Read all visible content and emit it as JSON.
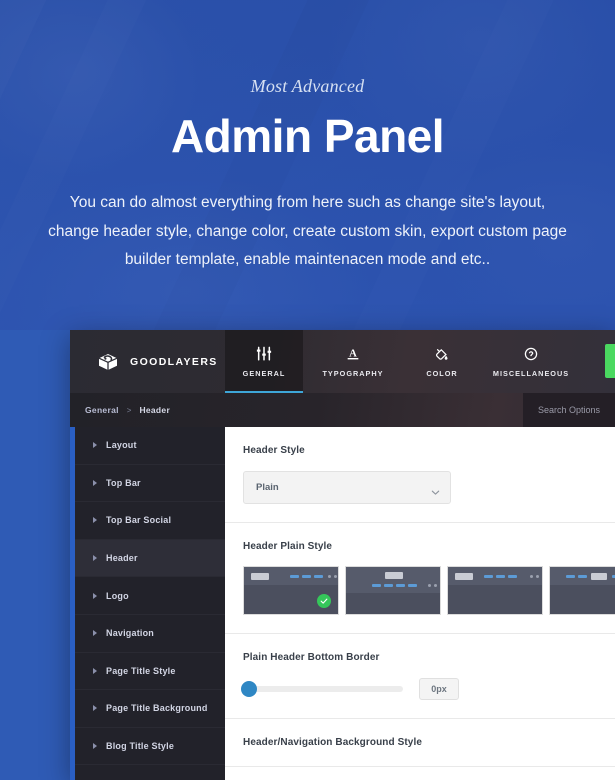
{
  "hero": {
    "eyebrow": "Most Advanced",
    "title": "Admin Panel",
    "description": "You can do almost everything from here such as change site's layout, change header style, change color, create custom skin, export custom page builder template, enable maintenacen mode and etc..",
    "bg_color": "#2f55a6"
  },
  "panel": {
    "brand": {
      "name": "GOODLAYERS",
      "icon": "cube-logo-icon"
    },
    "tabs": [
      {
        "label": "GENERAL",
        "icon": "sliders-icon",
        "active": true
      },
      {
        "label": "TYPOGRAPHY",
        "icon": "letter-a-underline-icon",
        "active": false
      },
      {
        "label": "COLOR",
        "icon": "paint-bucket-icon",
        "active": false
      },
      {
        "label": "MISCELLANEOUS",
        "icon": "circle-target-icon",
        "active": false
      }
    ],
    "save_button": {
      "label": "",
      "color": "#4ad860"
    },
    "breadcrumb": {
      "root": "General",
      "separator": ">",
      "current": "Header"
    },
    "search": {
      "placeholder": "Search Options",
      "value": ""
    },
    "sidebar": {
      "items": [
        {
          "label": "Layout",
          "active": false
        },
        {
          "label": "Top Bar",
          "active": false
        },
        {
          "label": "Top Bar Social",
          "active": false
        },
        {
          "label": "Header",
          "active": true
        },
        {
          "label": "Logo",
          "active": false
        },
        {
          "label": "Navigation",
          "active": false
        },
        {
          "label": "Page Title Style",
          "active": false
        },
        {
          "label": "Page Title Background",
          "active": false
        },
        {
          "label": "Blog Title Style",
          "active": false
        }
      ]
    },
    "fields": {
      "header_style": {
        "label": "Header Style",
        "selected": "Plain",
        "options": [
          "Plain"
        ]
      },
      "header_plain_style": {
        "label": "Header Plain Style",
        "selected_index": 0,
        "thumbnails": [
          {
            "name": "logo-left-nav-right",
            "selected": true
          },
          {
            "name": "logo-center-nav-below",
            "selected": false
          },
          {
            "name": "logo-left-nav-right-alt",
            "selected": false
          },
          {
            "name": "logo-center-nav-split",
            "selected": false
          }
        ]
      },
      "plain_header_bottom_border": {
        "label": "Plain Header Bottom Border",
        "value": "0px",
        "slider_percent": 0
      },
      "header_nav_background_style": {
        "label": "Header/Navigation Background Style"
      }
    }
  }
}
